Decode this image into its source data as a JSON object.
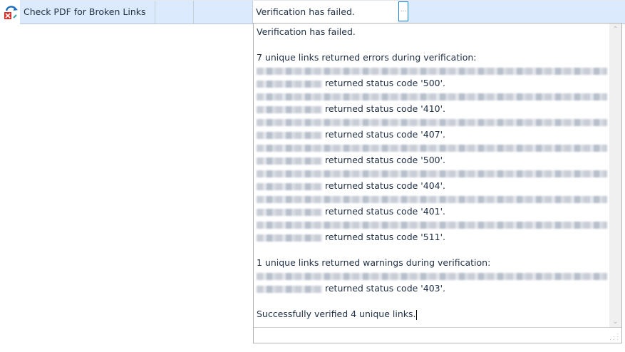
{
  "row": {
    "task": "Check PDF for Broken Links",
    "status": "Verification has failed.",
    "ellipsis": "..."
  },
  "popup": {
    "header": "Verification has failed.",
    "errors_heading": "7 unique links returned errors during verification:",
    "errors": [
      "returned status code '500'.",
      "returned status code '410'.",
      "returned status code '407'.",
      "returned status code '500'.",
      "returned status code '404'.",
      "returned status code '401'.",
      "returned status code '511'."
    ],
    "warnings_heading": "1 unique links returned warnings during verification:",
    "warnings": [
      "returned status code '403'."
    ],
    "summary": "Successfully verified 4 unique links."
  }
}
